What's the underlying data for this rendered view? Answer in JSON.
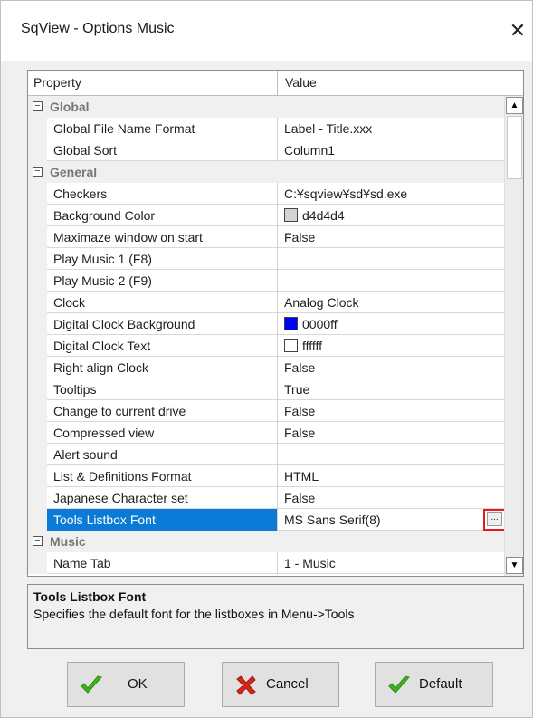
{
  "window": {
    "title": "SqView - Options Music",
    "close_glyph": "✕"
  },
  "grid": {
    "headers": {
      "property": "Property",
      "value": "Value"
    },
    "rows": [
      {
        "type": "category",
        "expander": "−",
        "name": "Global"
      },
      {
        "name": "Global File Name Format",
        "value": "Label - Title.xxx"
      },
      {
        "name": "Global Sort",
        "value": "Column1"
      },
      {
        "type": "category",
        "expander": "−",
        "name": "General"
      },
      {
        "name": "Checkers",
        "value": "C:¥sqview¥sd¥sd.exe"
      },
      {
        "name": "Background Color",
        "value": "d4d4d4",
        "swatch": "#d4d4d4"
      },
      {
        "name": "Maximaze window on start",
        "value": "False"
      },
      {
        "name": "Play Music 1 (F8)",
        "value": ""
      },
      {
        "name": "Play Music 2 (F9)",
        "value": ""
      },
      {
        "name": "Clock",
        "value": "Analog Clock"
      },
      {
        "name": "Digital Clock Background",
        "value": "0000ff",
        "swatch": "#0000ff"
      },
      {
        "name": "Digital Clock Text",
        "value": "ffffff",
        "swatch": "#ffffff"
      },
      {
        "name": "Right align Clock",
        "value": "False"
      },
      {
        "name": "Tooltips",
        "value": "True"
      },
      {
        "name": "Change to current drive",
        "value": "False"
      },
      {
        "name": "Compressed view",
        "value": "False"
      },
      {
        "name": "Alert sound",
        "value": ""
      },
      {
        "name": "List & Definitions Format",
        "value": "HTML"
      },
      {
        "name": "Japanese Character set",
        "value": "False"
      },
      {
        "name": "Tools Listbox Font",
        "value": "MS Sans Serif(8)",
        "selected": true,
        "ellipsis": "..."
      },
      {
        "type": "category",
        "expander": "−",
        "name": "Music"
      },
      {
        "name": "Name Tab",
        "value": "1 - Music"
      }
    ]
  },
  "scrollbar": {
    "up_glyph": "▲",
    "down_glyph": "▼"
  },
  "description": {
    "title": "Tools Listbox Font",
    "text": "Specifies the default font for the listboxes in Menu->Tools"
  },
  "buttons": {
    "ok": {
      "label": "OK",
      "icon": "check-icon"
    },
    "cancel": {
      "label": "Cancel",
      "icon": "cross-icon"
    },
    "default": {
      "label": "Default",
      "icon": "check-icon"
    }
  },
  "colors": {
    "selection": "#0a7ad7",
    "highlight_box": "#e81919",
    "check_green": "#3fb320",
    "cross_red": "#d9261c"
  }
}
